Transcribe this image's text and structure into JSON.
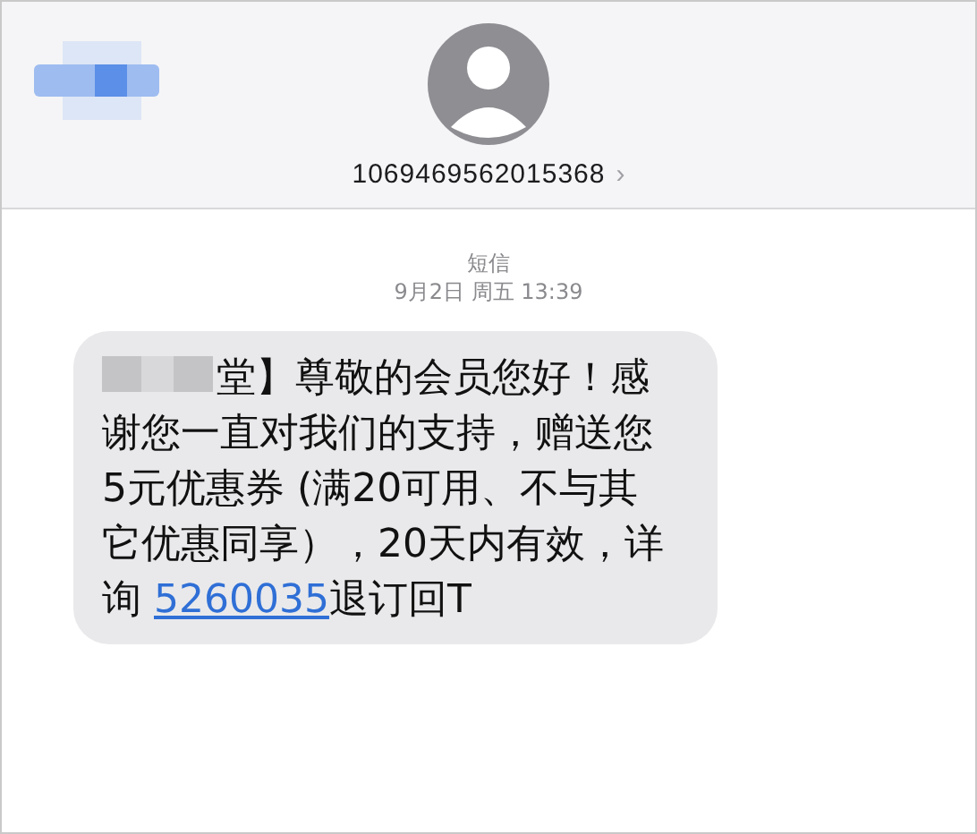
{
  "contact": {
    "number": "1069469562015368",
    "chevron": "›"
  },
  "thread": {
    "service": "短信",
    "timestamp": "9月2日 周五 13:39"
  },
  "message": {
    "lines": [
      "堂】尊敬的会员您好！感",
      "谢您一直对我们的支持，赠送您",
      "5元优惠券 (满20可用、不与其",
      "它优惠同享），20天内有效，详"
    ],
    "last_prefix": "询 ",
    "link": "5260035",
    "last_suffix": "退订回T"
  }
}
